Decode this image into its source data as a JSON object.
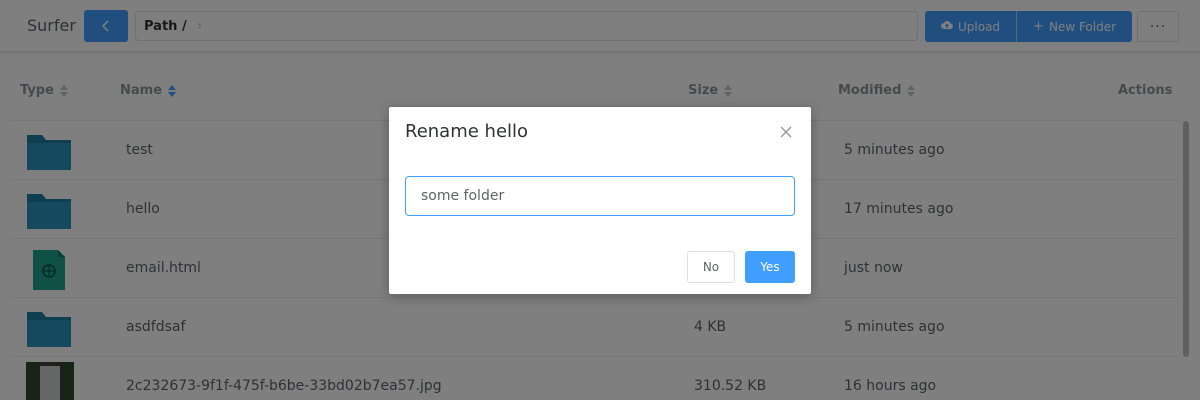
{
  "header": {
    "title": "Surfer",
    "path_label": "Path /",
    "upload_label": "Upload",
    "new_folder_label": "New Folder",
    "more_label": "···"
  },
  "table": {
    "columns": {
      "type": "Type",
      "name": "Name",
      "size": "Size",
      "modified": "Modified",
      "actions": "Actions"
    },
    "rows": [
      {
        "icon": "folder-icon",
        "name": "test",
        "size": "",
        "modified": "5 minutes ago"
      },
      {
        "icon": "folder-icon",
        "name": "hello",
        "size": "",
        "modified": "17 minutes ago"
      },
      {
        "icon": "html-file-icon",
        "name": "email.html",
        "size": "",
        "modified": "just now"
      },
      {
        "icon": "folder-icon",
        "name": "asdfdsaf",
        "size": "4 KB",
        "modified": "5 minutes ago"
      },
      {
        "icon": "image-thumbnail",
        "name": "2c232673-9f1f-475f-b6be-33bd02b7ea57.jpg",
        "size": "310.52 KB",
        "modified": "16 hours ago"
      }
    ]
  },
  "dialog": {
    "title": "Rename hello",
    "input_value": "some folder",
    "no_label": "No",
    "yes_label": "Yes"
  },
  "colors": {
    "accent": "#409eff",
    "folder": "#1b7ea3",
    "html_file": "#1fa28f"
  }
}
